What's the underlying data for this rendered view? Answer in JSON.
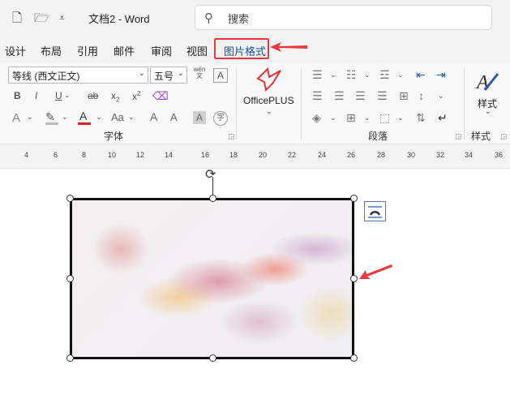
{
  "titlebar": {
    "title": "文档2  -  Word",
    "search_icon": "search-icon",
    "search_placeholder": "搜索"
  },
  "tabs": {
    "items": [
      "设计",
      "布局",
      "引用",
      "邮件",
      "审阅",
      "视图",
      "图片格式"
    ],
    "active": "图片格式"
  },
  "ribbon": {
    "font_name": "等线 (西文正文)",
    "font_size": "五号",
    "wen_top": "wén",
    "wen_bottom": "文",
    "bold": "B",
    "italic": "I",
    "underline": "U",
    "strike": "ab",
    "sub_base": "x",
    "sub_mark": "2",
    "sup_base": "x",
    "sup_mark": "2",
    "font_color_letter": "A",
    "case_letter": "Aa",
    "grow_letter": "A",
    "shrink_letter": "A",
    "char_shade_letter": "A",
    "enclose_char": "字",
    "group_font": "字体",
    "officeplus": "OfficePLUS",
    "group_paragraph": "段落",
    "styles_label": "样式",
    "group_styles": "样式",
    "accent_red": "#e8383d",
    "accent_blue": "#1a4f94"
  },
  "ruler": {
    "marks": [
      "4",
      "6",
      "8",
      "10",
      "12",
      "14",
      "16",
      "18",
      "20",
      "22",
      "24",
      "26",
      "28",
      "30",
      "32",
      "34",
      "36"
    ]
  }
}
